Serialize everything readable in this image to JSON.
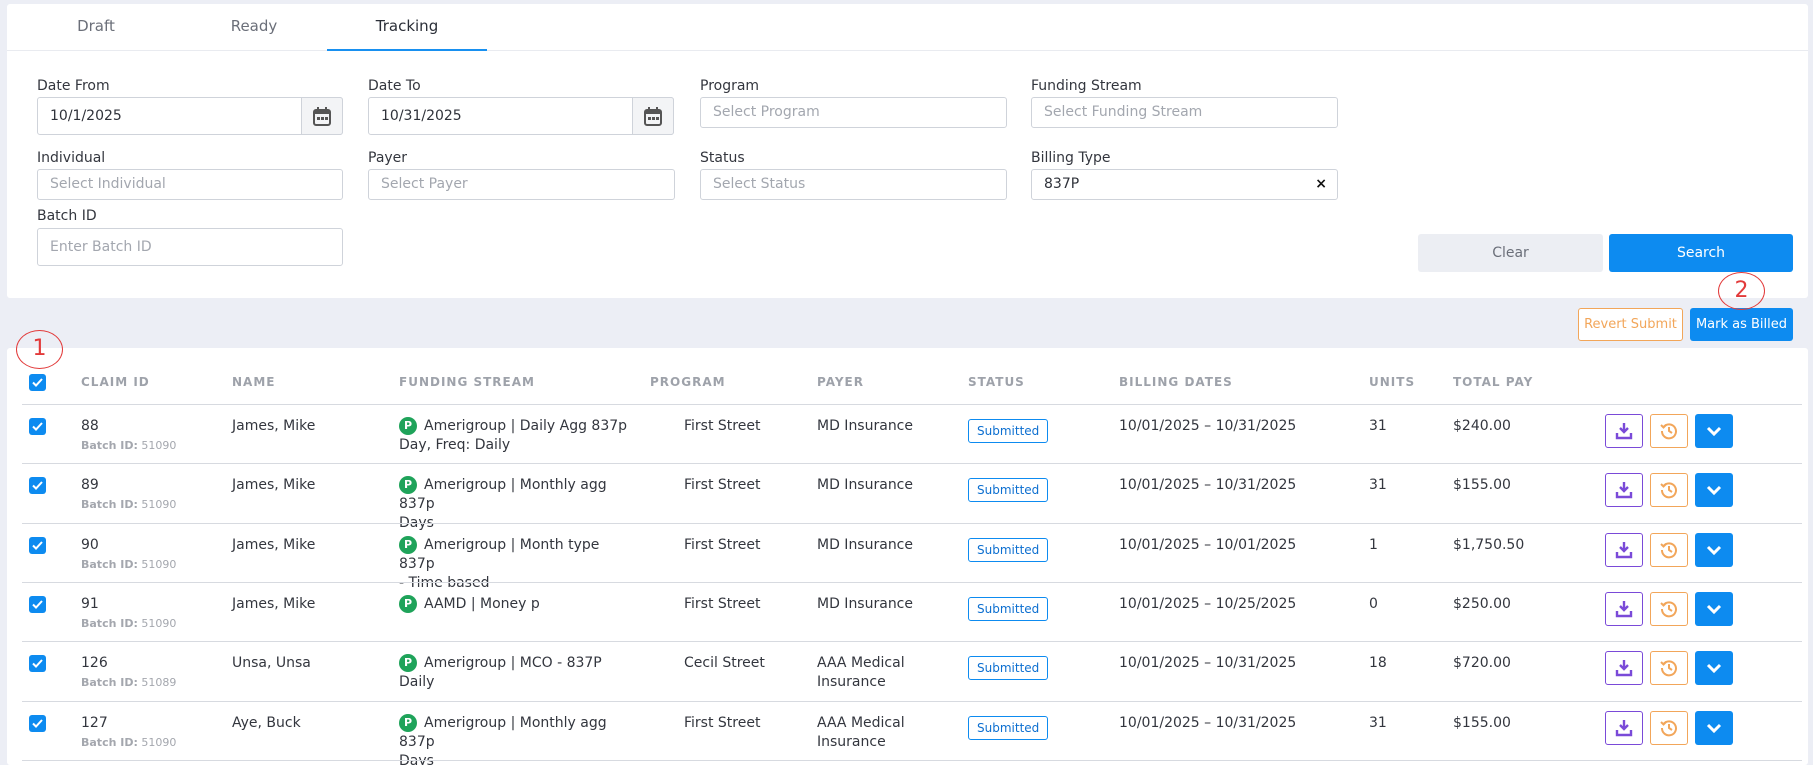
{
  "tabs": [
    "Draft",
    "Ready",
    "Tracking"
  ],
  "filters": {
    "date_from": {
      "label": "Date From",
      "value": "10/1/2025"
    },
    "date_to": {
      "label": "Date To",
      "value": "10/31/2025"
    },
    "program": {
      "label": "Program",
      "placeholder": "Select Program"
    },
    "funding_stream": {
      "label": "Funding Stream",
      "placeholder": "Select Funding Stream"
    },
    "individual": {
      "label": "Individual",
      "placeholder": "Select Individual"
    },
    "payer": {
      "label": "Payer",
      "placeholder": "Select Payer"
    },
    "status": {
      "label": "Status",
      "placeholder": "Select Status"
    },
    "billing_type": {
      "label": "Billing Type",
      "value": "837P",
      "clear": "×"
    },
    "batch_id": {
      "label": "Batch ID",
      "placeholder": "Enter Batch ID"
    }
  },
  "buttons": {
    "clear": "Clear",
    "search": "Search",
    "revert": "Revert Submit",
    "mark_billed": "Mark as Billed"
  },
  "annotations": {
    "one": "1",
    "two": "2"
  },
  "table": {
    "headers": {
      "claim_id": "CLAIM ID",
      "name": "NAME",
      "funding": "FUNDING STREAM",
      "program": "PROGRAM",
      "payer": "PAYER",
      "status": "STATUS",
      "billing": "BILLING DATES",
      "units": "UNITS",
      "total": "TOTAL PAY"
    },
    "batch_label": "Batch ID:",
    "p_badge": "P",
    "rows": [
      {
        "claim": "88",
        "batch": "51090",
        "name": "James, Mike",
        "funding": "Amerigroup | Daily Agg 837p",
        "funding2": "Day, Freq: Daily",
        "program": "First Street",
        "payer": "MD Insurance",
        "payer2": "",
        "status": "Submitted",
        "dates": "10/01/2025 – 10/31/2025",
        "units": "31",
        "total": "$240.00"
      },
      {
        "claim": "89",
        "batch": "51090",
        "name": "James, Mike",
        "funding": "Amerigroup | Monthly agg 837p",
        "funding2": "Days",
        "program": "First Street",
        "payer": "MD Insurance",
        "payer2": "",
        "status": "Submitted",
        "dates": "10/01/2025 – 10/31/2025",
        "units": "31",
        "total": "$155.00"
      },
      {
        "claim": "90",
        "batch": "51090",
        "name": "James, Mike",
        "funding": "Amerigroup | Month type 837p",
        "funding2": "- Time based",
        "program": "First Street",
        "payer": "MD Insurance",
        "payer2": "",
        "status": "Submitted",
        "dates": "10/01/2025 – 10/01/2025",
        "units": "1",
        "total": "$1,750.50"
      },
      {
        "claim": "91",
        "batch": "51090",
        "name": "James, Mike",
        "funding": "AAMD | Money p",
        "funding2": "",
        "program": "First Street",
        "payer": "MD Insurance",
        "payer2": "",
        "status": "Submitted",
        "dates": "10/01/2025 – 10/25/2025",
        "units": "0",
        "total": "$250.00"
      },
      {
        "claim": "126",
        "batch": "51089",
        "name": "Unsa, Unsa",
        "funding": "Amerigroup | MCO - 837P Daily",
        "funding2": "",
        "program": "Cecil Street",
        "payer": "AAA Medical",
        "payer2": "Insurance",
        "status": "Submitted",
        "dates": "10/01/2025 – 10/31/2025",
        "units": "18",
        "total": "$720.00"
      },
      {
        "claim": "127",
        "batch": "51090",
        "name": "Aye, Buck",
        "funding": "Amerigroup | Monthly agg 837p",
        "funding2": "Days",
        "program": "First Street",
        "payer": "AAA Medical",
        "payer2": "Insurance",
        "status": "Submitted",
        "dates": "10/01/2025 – 10/31/2025",
        "units": "31",
        "total": "$155.00"
      }
    ]
  },
  "colors": {
    "accent": "#0d8bf0",
    "warning": "#f2a65a",
    "purple": "#7a4ad8",
    "success": "#1fa35a",
    "annotation": "#e23a3a"
  },
  "icons": {
    "calendar": "calendar-icon",
    "download": "download-icon",
    "history": "history-icon",
    "expand": "chevron-down-icon",
    "check": "check-icon"
  }
}
